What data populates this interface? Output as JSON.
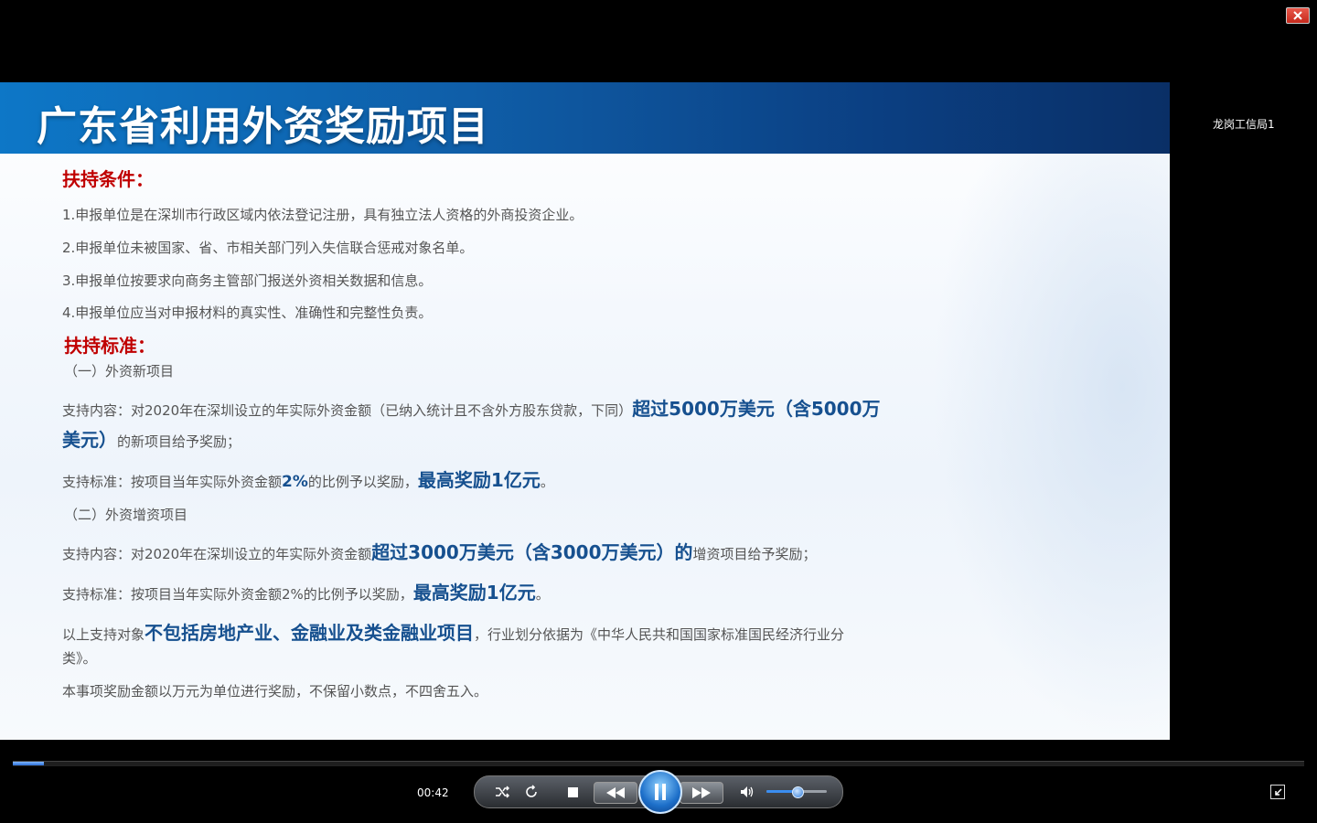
{
  "window": {
    "close_label": "close"
  },
  "slide": {
    "title": "广东省利用外资奖励项目",
    "section1": "扶持条件：",
    "conditions": [
      "1.申报单位是在深圳市行政区域内依法登记注册，具有独立法人资格的外商投资企业。",
      "2.申报单位未被国家、省、市相关部门列入失信联合惩戒对象名单。",
      "3.申报单位按要求向商务主管部门报送外资相关数据和信息。",
      "4.申报单位应当对申报材料的真实性、准确性和完整性负责。"
    ],
    "section2": "扶持标准：",
    "sub1": "（一）外资新项目",
    "sub1_content_prefix": "支持内容：对2020年在深圳设立的年实际外资金额（已纳入统计且不含外方股东贷款，下同）",
    "sub1_content_hl1": "超过5000万美元（含5000万",
    "sub1_content_hl2": "美元）",
    "sub1_content_suffix": "的新项目给予奖励；",
    "sub1_std_prefix": "支持标准：按项目当年实际外资金额",
    "sub1_std_pct": "2%",
    "sub1_std_mid": "的比例予以奖励，",
    "sub1_std_hl": "最高奖励1亿元",
    "sub1_std_end": "。",
    "sub2": "（二）外资增资项目",
    "sub2_content_prefix": "支持内容：对2020年在深圳设立的年实际外资金额",
    "sub2_content_hl": "超过3000万美元（含3000万美元）的",
    "sub2_content_suffix": "增资项目给予奖励；",
    "sub2_std_prefix": "支持标准：按项目当年实际外资金额2%的比例予以奖励，",
    "sub2_std_hl": "最高奖励1亿元",
    "sub2_std_end": "。",
    "note1_prefix": "以上支持对象",
    "note1_hl": "不包括房地产业、金融业及类金融业项目",
    "note1_suffix": "，行业划分依据为《中华人民共和国国家标准国民经济行业分",
    "note1_line2": "类》。",
    "note2": "本事项奖励金额以万元为单位进行奖励，不保留小数点，不四舍五入。"
  },
  "side_label": "龙岗工信局1",
  "player": {
    "time": "00:42",
    "progress_fraction": 0.024,
    "volume_fraction": 0.5
  }
}
